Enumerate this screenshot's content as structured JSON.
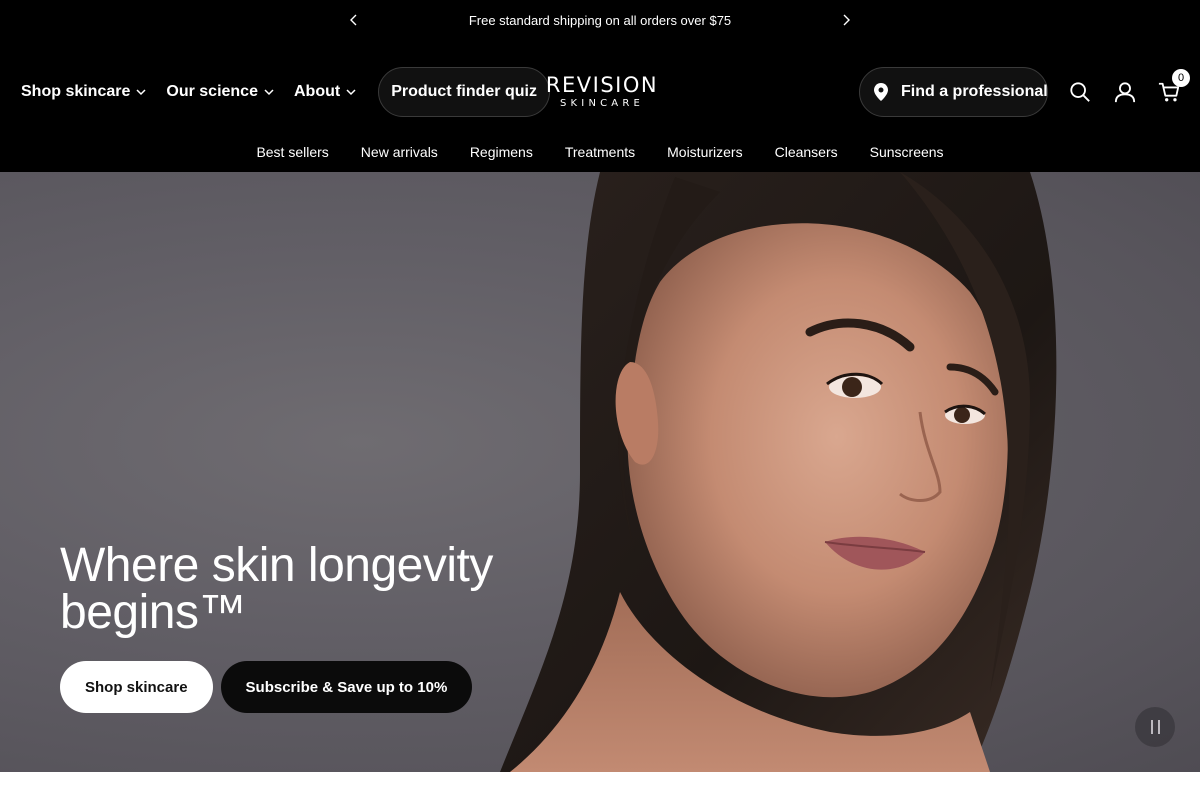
{
  "announcement": {
    "message": "Free standard shipping on all orders over $75",
    "prev_icon": "chevron-left-icon",
    "next_icon": "chevron-right-icon"
  },
  "header": {
    "nav": [
      {
        "label": "Shop skincare",
        "has_dropdown": true
      },
      {
        "label": "Our science",
        "has_dropdown": true
      },
      {
        "label": "About",
        "has_dropdown": true
      }
    ],
    "quiz_button": "Product finder quiz",
    "logo": {
      "line1": "REVISION",
      "line2": "SKINCARE"
    },
    "find_professional": "Find a professional",
    "cart_count": "0",
    "icons": [
      "search-icon",
      "user-icon",
      "cart-icon",
      "location-pin-icon"
    ]
  },
  "subnav": {
    "items": [
      "Best sellers",
      "New arrivals",
      "Regimens",
      "Treatments",
      "Moisturizers",
      "Cleansers",
      "Sunscreens"
    ]
  },
  "hero": {
    "title": "Where skin longevity begins™",
    "primary_button": "Shop skincare",
    "secondary_button": "Subscribe & Save up to 10%",
    "pause_icon": "pause-icon"
  },
  "colors": {
    "header_bg": "#000000",
    "hero_bg": "#625f66",
    "primary_btn_bg": "#ffffff",
    "secondary_btn_bg": "#0b0b0b"
  }
}
